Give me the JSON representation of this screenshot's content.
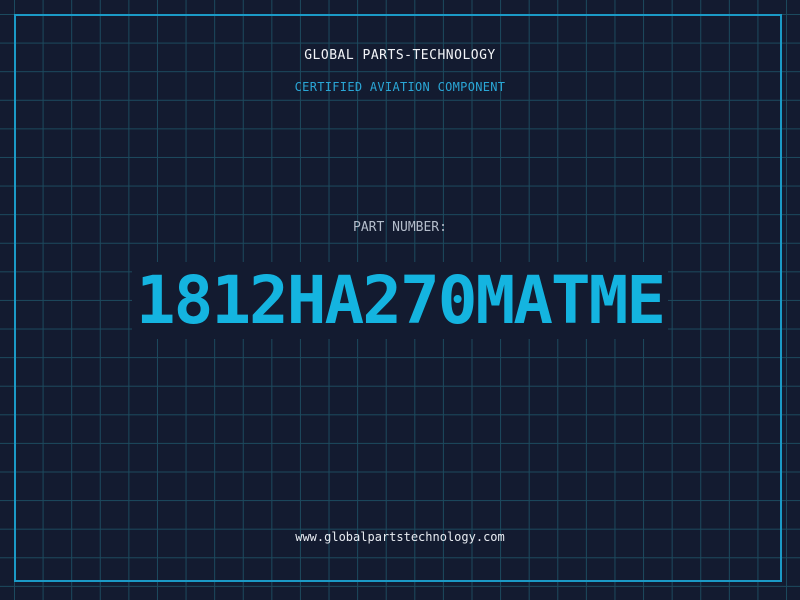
{
  "header": {
    "company": "GLOBAL PARTS-TECHNOLOGY",
    "subtitle": "CERTIFIED AVIATION COMPONENT"
  },
  "part": {
    "label": "PART NUMBER:",
    "number": "1812HA270MATME"
  },
  "footer": {
    "website": "www.globalpartstechnology.com"
  },
  "colors": {
    "background": "#131b30",
    "grid": "#1c4a5e",
    "accent": "#14b4e0",
    "frame": "#1b9ac6"
  }
}
